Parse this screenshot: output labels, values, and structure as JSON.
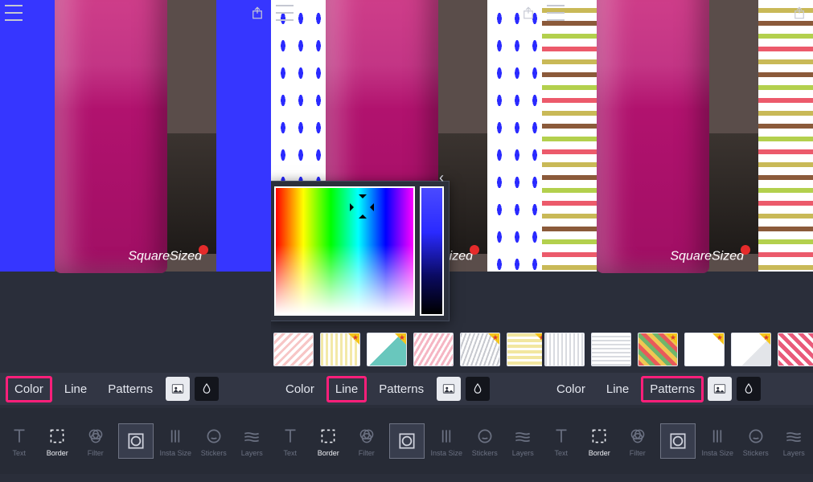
{
  "app": {
    "watermark": "SquareSized"
  },
  "panels": [
    {
      "id": 0,
      "active_subtab": "Color",
      "subtabs": [
        "Color",
        "Line",
        "Patterns"
      ],
      "tools": [
        "Text",
        "Border",
        "Filter",
        "|",
        "Insta Size",
        "Stickers",
        "Layers"
      ],
      "active_tool": "Border"
    },
    {
      "id": 1,
      "active_subtab": "Line",
      "subtabs": [
        "Color",
        "Line",
        "Patterns"
      ],
      "tools": [
        "Text",
        "Border",
        "Filter",
        "|",
        "Insta Size",
        "Stickers",
        "Layers"
      ],
      "active_tool": "Border",
      "has_picker": true
    },
    {
      "id": 2,
      "active_subtab": "Patterns",
      "subtabs": [
        "Color",
        "Line",
        "Patterns"
      ],
      "tools": [
        "Text",
        "Border",
        "Filter",
        "|",
        "Insta Size",
        "Stickers",
        "Layers"
      ],
      "active_tool": "Border"
    }
  ],
  "pattern_thumbs": [
    {
      "premium": false
    },
    {
      "premium": true
    },
    {
      "premium": true
    },
    {
      "premium": false
    },
    {
      "premium": true
    },
    {
      "premium": true
    },
    {
      "premium": false
    },
    {
      "premium": false
    },
    {
      "premium": true
    },
    {
      "premium": true
    },
    {
      "premium": true
    },
    {
      "premium": false
    }
  ],
  "colors": {
    "accent": "#3636ff",
    "highlight": "#ff1f7a"
  }
}
